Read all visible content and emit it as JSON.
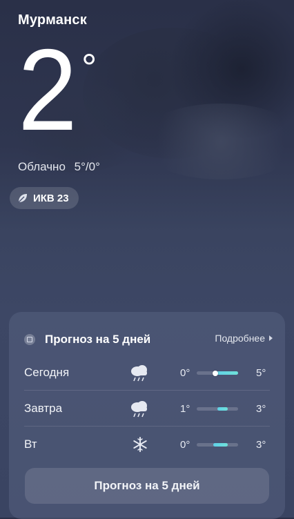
{
  "location": {
    "city": "Мурманск"
  },
  "current": {
    "temperature": "2",
    "degree_symbol": "°",
    "condition": "Облачно",
    "high_low": "5°/0°"
  },
  "air_quality": {
    "label": "ИКВ 23",
    "icon": "leaf-icon"
  },
  "forecast": {
    "title": "Прогноз на 5 дней",
    "more_label": "Подробнее",
    "button_label": "Прогноз на 5 дней",
    "days": [
      {
        "day": "Сегодня",
        "icon": "rain-cloud-icon",
        "low": "0°",
        "high": "5°",
        "range_fill": [
          0.4,
          1.0
        ],
        "current_marker": 0.45
      },
      {
        "day": "Завтра",
        "icon": "rain-cloud-icon",
        "low": "1°",
        "high": "3°",
        "range_fill": [
          0.5,
          0.75
        ]
      },
      {
        "day": "Вт",
        "icon": "snowflake-icon",
        "low": "0°",
        "high": "3°",
        "range_fill": [
          0.4,
          0.75
        ]
      }
    ]
  },
  "colors": {
    "bar_fill": "#5fd0e8",
    "background": "#3a4462"
  }
}
